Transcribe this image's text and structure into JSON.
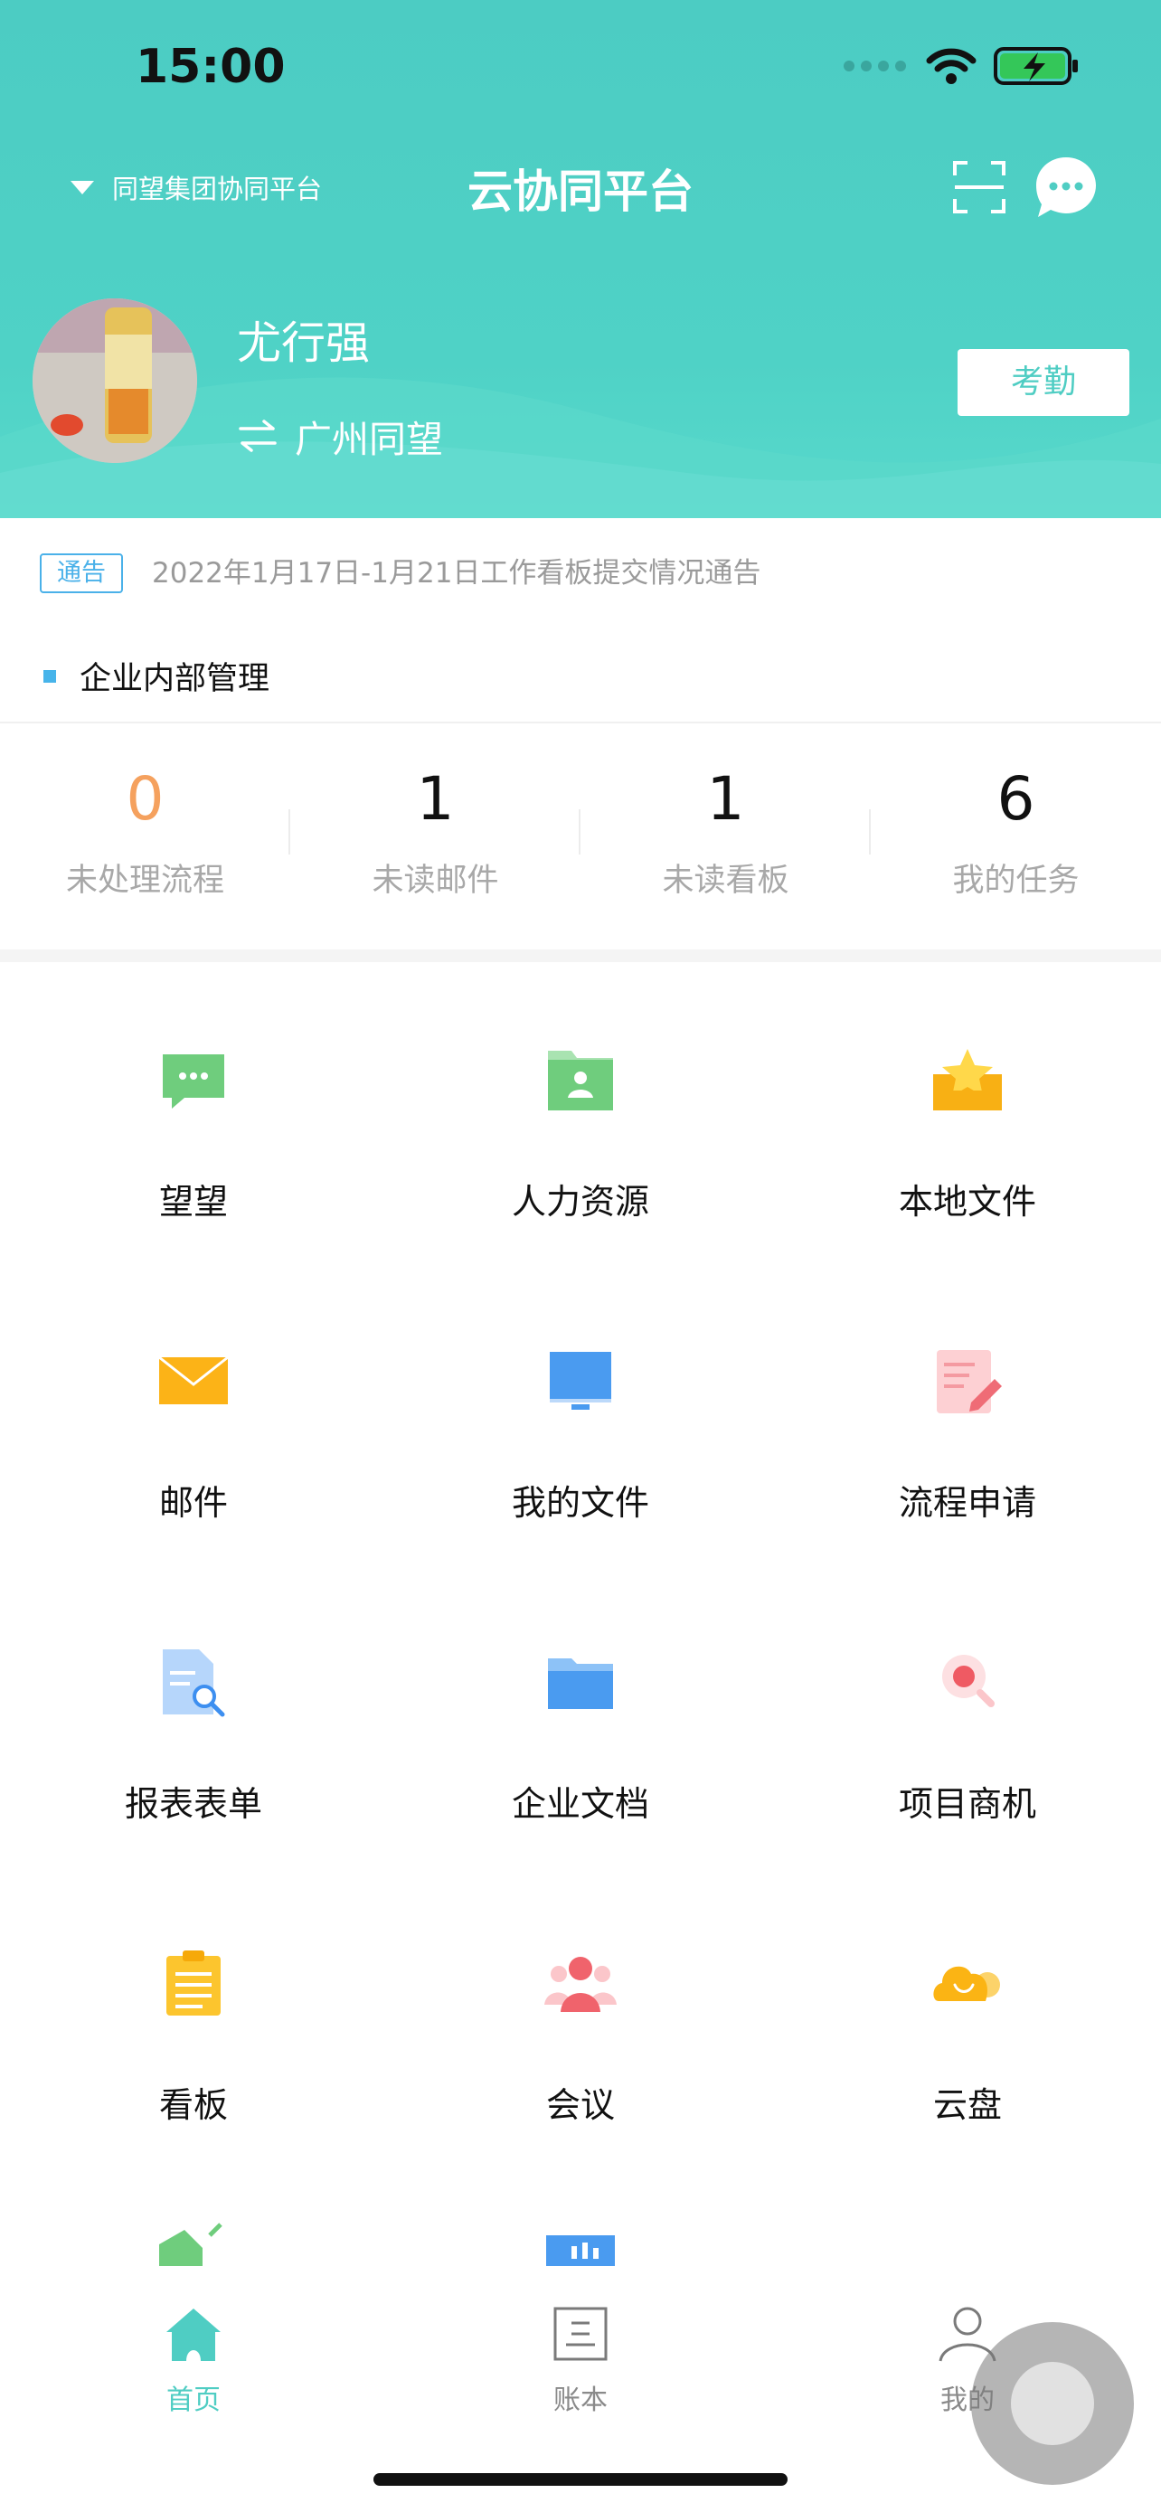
{
  "status_bar": {
    "time": "15:00"
  },
  "header": {
    "org_name": "同望集团协同平台",
    "title": "云协同平台",
    "user_name": "尤行强",
    "company": "广州同望",
    "attendance_label": "考勤"
  },
  "notice": {
    "tag": "通告",
    "text": "2022年1月17日-1月21日工作看板提交情况通告"
  },
  "section": {
    "title": "企业内部管理"
  },
  "stats": [
    {
      "value": "0",
      "label": "未处理流程"
    },
    {
      "value": "1",
      "label": "未读邮件"
    },
    {
      "value": "1",
      "label": "未读看板"
    },
    {
      "value": "6",
      "label": "我的任务"
    }
  ],
  "apps": [
    {
      "label": "望望",
      "icon": "chat-bubble-icon"
    },
    {
      "label": "人力资源",
      "icon": "hr-folder-icon"
    },
    {
      "label": "本地文件",
      "icon": "star-box-icon"
    },
    {
      "label": "邮件",
      "icon": "envelope-icon"
    },
    {
      "label": "我的文件",
      "icon": "monitor-icon"
    },
    {
      "label": "流程申请",
      "icon": "form-edit-icon"
    },
    {
      "label": "报表表单",
      "icon": "report-search-icon"
    },
    {
      "label": "企业文档",
      "icon": "folder-icon"
    },
    {
      "label": "项目商机",
      "icon": "magnifier-icon"
    },
    {
      "label": "看板",
      "icon": "clipboard-icon"
    },
    {
      "label": "会议",
      "icon": "meeting-people-icon"
    },
    {
      "label": "云盘",
      "icon": "cloud-icon"
    }
  ],
  "tabs": [
    {
      "label": "首页",
      "icon": "home-icon"
    },
    {
      "label": "账本",
      "icon": "ledger-icon"
    },
    {
      "label": "我的",
      "icon": "person-icon"
    }
  ],
  "colors": {
    "header": "#4fcdc3",
    "accent": "#4fcdc3",
    "notice_tag": "#4ab1e9",
    "pending_stat": "#f5a15e"
  }
}
